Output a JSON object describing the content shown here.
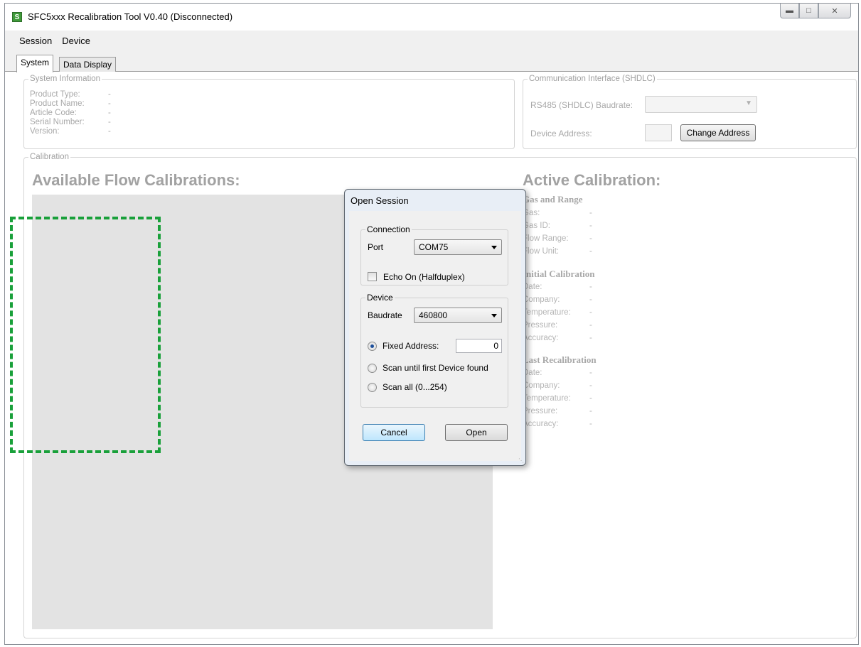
{
  "window": {
    "title": "SFC5xxx Recalibration Tool V0.40 (Disconnected)",
    "app_icon_letter": "S"
  },
  "menu": [
    "Session",
    "Device"
  ],
  "tabs": [
    "System",
    "Data Display"
  ],
  "system_info": {
    "legend": "System Information",
    "rows": [
      {
        "label": "Product Type:",
        "value": "-"
      },
      {
        "label": "Product Name:",
        "value": "-"
      },
      {
        "label": "Article Code:",
        "value": "-"
      },
      {
        "label": "Serial Number:",
        "value": "-"
      },
      {
        "label": "Version:",
        "value": "-"
      }
    ]
  },
  "comm": {
    "legend": "Communication Interface (SHDLC)",
    "baudrate_label": "RS485 (SHDLC) Baudrate:",
    "address_label": "Device Address:",
    "change_button": "Change Address"
  },
  "calibration": {
    "legend": "Calibration",
    "available_heading": "Available Flow Calibrations:",
    "active_heading": "Active Calibration:",
    "sections": [
      {
        "title": "Gas and Range",
        "rows": [
          {
            "label": "Gas:",
            "value": "-"
          },
          {
            "label": "Gas ID:",
            "value": "-"
          },
          {
            "label": "Flow Range:",
            "value": "-"
          },
          {
            "label": "Flow Unit:",
            "value": "-"
          }
        ]
      },
      {
        "title": "Initial Calibration",
        "rows": [
          {
            "label": "Date:",
            "value": "-"
          },
          {
            "label": "Company:",
            "value": "-"
          },
          {
            "label": "Temperature:",
            "value": "-"
          },
          {
            "label": "Pressure:",
            "value": "-"
          },
          {
            "label": "Accuracy:",
            "value": "-"
          }
        ]
      },
      {
        "title": "Last Recalibration",
        "rows": [
          {
            "label": "Date:",
            "value": "-"
          },
          {
            "label": "Company:",
            "value": "-"
          },
          {
            "label": "Temperature:",
            "value": "-"
          },
          {
            "label": "Pressure:",
            "value": "-"
          },
          {
            "label": "Accuracy:",
            "value": "-"
          }
        ]
      }
    ]
  },
  "dialog": {
    "title": "Open Session",
    "connection_legend": "Connection",
    "port_label": "Port",
    "port_value": "COM75",
    "echo_label": "Echo On (Halfduplex)",
    "echo_checked": false,
    "device_legend": "Device",
    "baudrate_label": "Baudrate",
    "baudrate_value": "460800",
    "fixed_address_label": "Fixed Address:",
    "fixed_address_value": "0",
    "scan_first_label": "Scan until first Device found",
    "scan_all_label": "Scan all (0...254)",
    "selected_mode": "fixed",
    "cancel": "Cancel",
    "open": "Open"
  },
  "colors": {
    "highlight_dashed": "#19a03a",
    "disabled_text": "#a8a8a8"
  }
}
